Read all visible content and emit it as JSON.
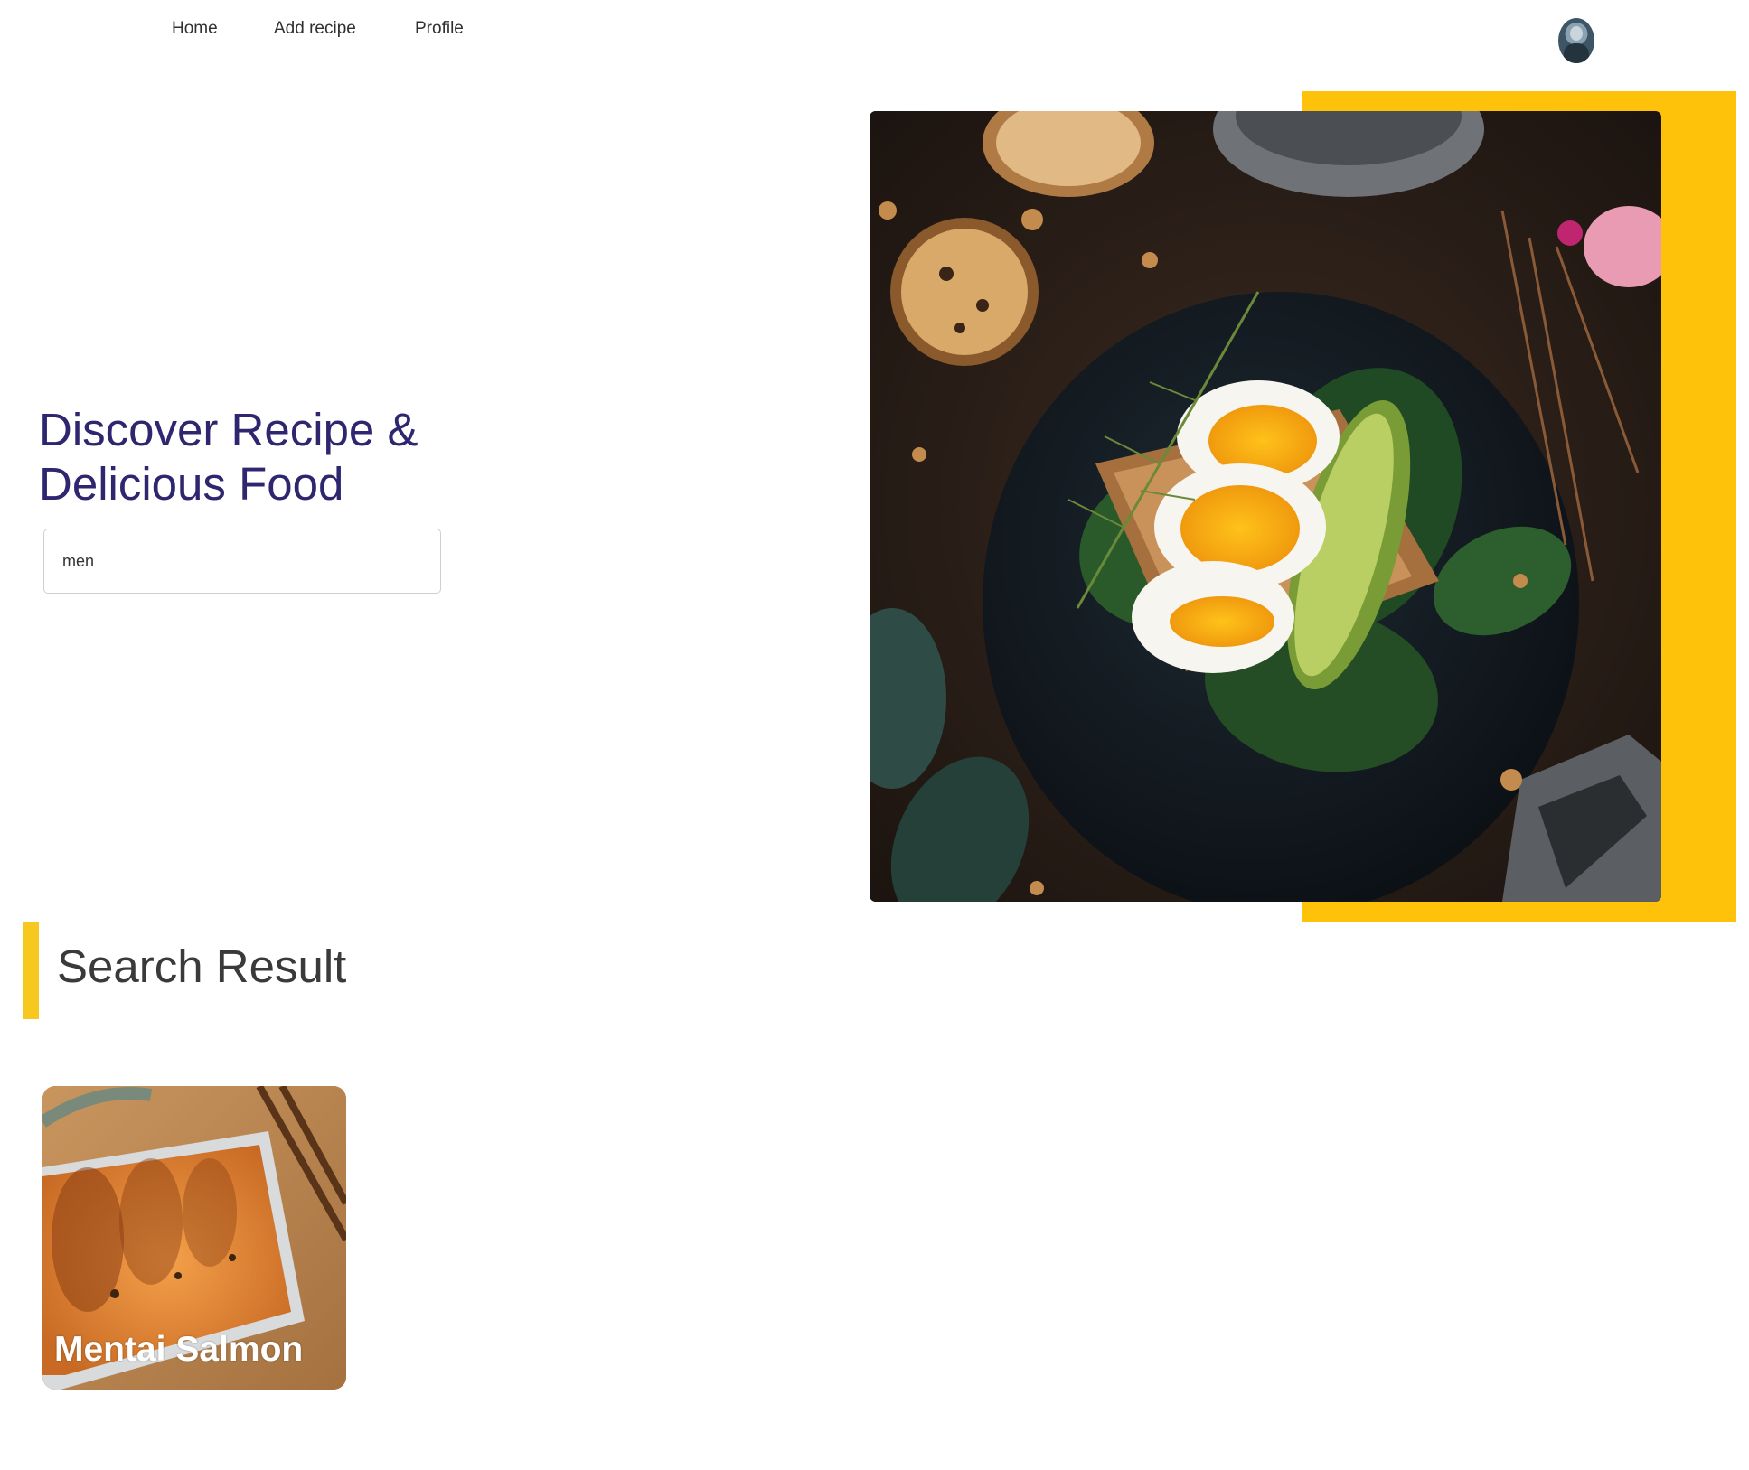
{
  "nav": {
    "links": [
      "Home",
      "Add recipe",
      "Profile"
    ]
  },
  "hero": {
    "title": "Discover Recipe & Delicious Food",
    "search": {
      "value": "men",
      "placeholder": ""
    }
  },
  "results": {
    "heading": "Search Result",
    "items": [
      {
        "title": "Mentai Salmon"
      }
    ]
  },
  "colors": {
    "accent_yellow": "#fec20b",
    "title_navy": "#2e266f"
  }
}
